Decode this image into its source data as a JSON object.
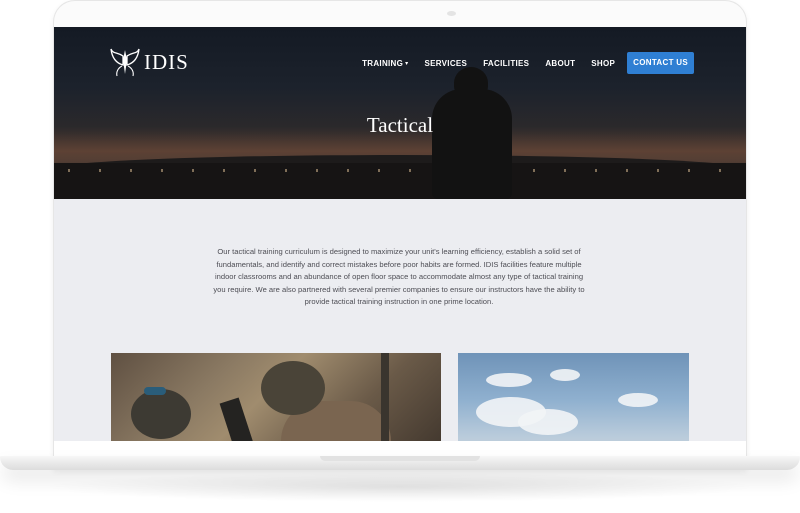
{
  "brand": {
    "name": "IDIS"
  },
  "nav": {
    "items": [
      {
        "label": "TRAINING",
        "has_dropdown": true
      },
      {
        "label": "SERVICES",
        "has_dropdown": false
      },
      {
        "label": "FACILITIES",
        "has_dropdown": false
      },
      {
        "label": "ABOUT",
        "has_dropdown": false
      },
      {
        "label": "SHOP",
        "has_dropdown": false
      }
    ],
    "cta_label": "CONTACT US",
    "dropdown_caret": "▾"
  },
  "hero": {
    "title": "Tactical"
  },
  "intro": {
    "text": "Our tactical training curriculum is designed to maximize your unit's learning efficiency, establish a solid set of fundamentals, and identify and correct mistakes before poor habits are formed. IDIS facilities feature multiple indoor classrooms and an abundance of open floor space to accommodate almost any type of tactical training you require. We are also partnered with several premier companies to ensure our instructors have the ability to provide tactical training instruction in one prime location."
  },
  "colors": {
    "accent": "#2f7fd3",
    "page_background": "#ecedf1",
    "body_text": "#4e4e55"
  },
  "icons": {
    "logo": "winged-emblem-icon",
    "dropdown": "chevron-down-icon"
  }
}
